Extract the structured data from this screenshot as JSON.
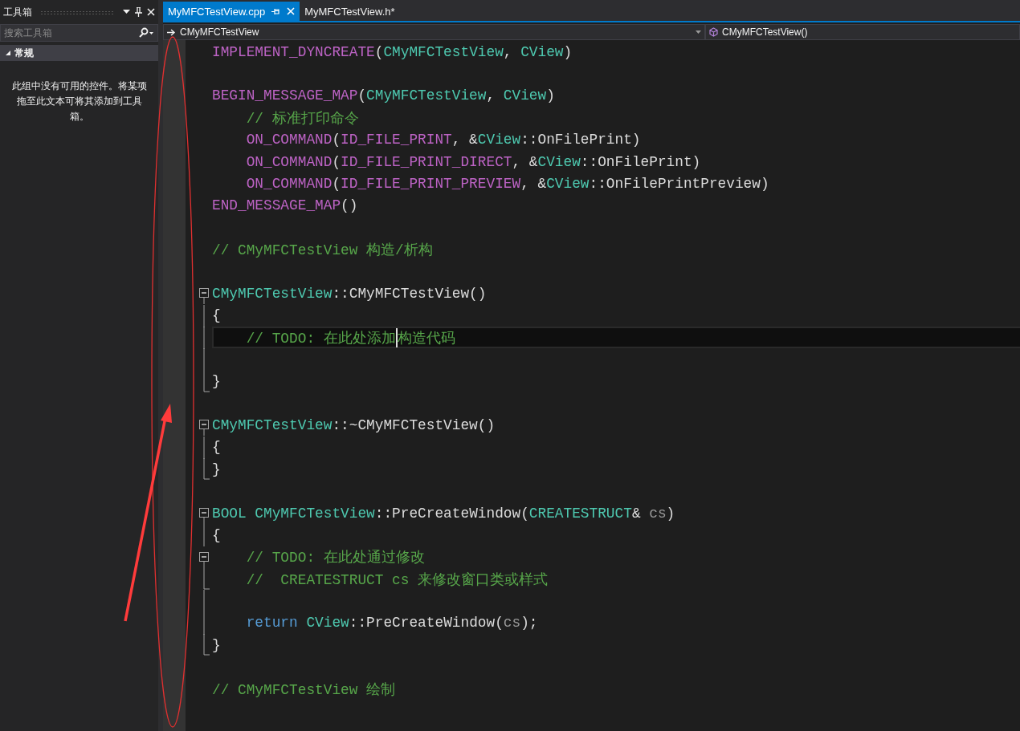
{
  "toolbox": {
    "title": "工具箱",
    "search": {
      "placeholder": "搜索工具箱"
    },
    "group": {
      "label": "常规",
      "expanded": true
    },
    "message": "此组中没有可用的控件。将某项拖至此文本可将其添加到工具箱。"
  },
  "tabs": [
    {
      "label": "MyMFCTestView.cpp",
      "selected": true
    },
    {
      "label": "MyMFCTestView.h*",
      "selected": false
    }
  ],
  "nav": {
    "scope": "CMyMFCTestView",
    "member": "CMyMFCTestView()"
  },
  "lines": [
    {
      "kind": "code",
      "tokens": [
        {
          "kind": "macro",
          "text": "IMPLEMENT_DYNCREATE"
        },
        {
          "kind": "text",
          "text": "("
        },
        {
          "kind": "type",
          "text": "CMyMFCTestView"
        },
        {
          "kind": "text",
          "text": ", "
        },
        {
          "kind": "type",
          "text": "CView"
        },
        {
          "kind": "text",
          "text": ")"
        }
      ]
    },
    {
      "kind": "blank"
    },
    {
      "kind": "code",
      "tokens": [
        {
          "kind": "macro",
          "text": "BEGIN_MESSAGE_MAP"
        },
        {
          "kind": "text",
          "text": "("
        },
        {
          "kind": "type",
          "text": "CMyMFCTestView"
        },
        {
          "kind": "text",
          "text": ", "
        },
        {
          "kind": "type",
          "text": "CView"
        },
        {
          "kind": "text",
          "text": ")"
        }
      ]
    },
    {
      "kind": "code",
      "tokens": [
        {
          "kind": "comment",
          "text": "    // 标准打印命令"
        }
      ]
    },
    {
      "kind": "code",
      "tokens": [
        {
          "kind": "macro",
          "text": "    ON_COMMAND"
        },
        {
          "kind": "text",
          "text": "("
        },
        {
          "kind": "macro",
          "text": "ID_FILE_PRINT"
        },
        {
          "kind": "text",
          "text": ", &"
        },
        {
          "kind": "type",
          "text": "CView"
        },
        {
          "kind": "text",
          "text": "::OnFilePrint)"
        }
      ]
    },
    {
      "kind": "code",
      "tokens": [
        {
          "kind": "macro",
          "text": "    ON_COMMAND"
        },
        {
          "kind": "text",
          "text": "("
        },
        {
          "kind": "macro",
          "text": "ID_FILE_PRINT_DIRECT"
        },
        {
          "kind": "text",
          "text": ", &"
        },
        {
          "kind": "type",
          "text": "CView"
        },
        {
          "kind": "text",
          "text": "::OnFilePrint)"
        }
      ]
    },
    {
      "kind": "code",
      "tokens": [
        {
          "kind": "macro",
          "text": "    ON_COMMAND"
        },
        {
          "kind": "text",
          "text": "("
        },
        {
          "kind": "macro",
          "text": "ID_FILE_PRINT_PREVIEW"
        },
        {
          "kind": "text",
          "text": ", &"
        },
        {
          "kind": "type",
          "text": "CView"
        },
        {
          "kind": "text",
          "text": "::OnFilePrintPreview)"
        }
      ]
    },
    {
      "kind": "code",
      "tokens": [
        {
          "kind": "macro",
          "text": "END_MESSAGE_MAP"
        },
        {
          "kind": "text",
          "text": "()"
        }
      ]
    },
    {
      "kind": "blank"
    },
    {
      "kind": "code",
      "tokens": [
        {
          "kind": "comment",
          "text": "// CMyMFCTestView 构造/析构"
        }
      ]
    },
    {
      "kind": "blank"
    },
    {
      "kind": "code",
      "collapsible": true,
      "tokens": [
        {
          "kind": "type",
          "text": "CMyMFCTestView"
        },
        {
          "kind": "text",
          "text": "::CMyMFCTestView()"
        }
      ]
    },
    {
      "kind": "code",
      "in_block": true,
      "tokens": [
        {
          "kind": "text",
          "text": "{"
        }
      ]
    },
    {
      "kind": "code",
      "in_block": true,
      "current": true,
      "tokens": [
        {
          "kind": "comment",
          "text": "    // TODO: 在此处添加"
        },
        {
          "kind": "comment",
          "text": "构造代码",
          "caret_before": true
        }
      ]
    },
    {
      "kind": "blank",
      "in_block": true
    },
    {
      "kind": "code",
      "block_end": true,
      "tokens": [
        {
          "kind": "text",
          "text": "}"
        }
      ]
    },
    {
      "kind": "blank"
    },
    {
      "kind": "code",
      "collapsible": true,
      "tokens": [
        {
          "kind": "type",
          "text": "CMyMFCTestView"
        },
        {
          "kind": "text",
          "text": "::~CMyMFCTestView()"
        }
      ]
    },
    {
      "kind": "code",
      "in_block": true,
      "tokens": [
        {
          "kind": "text",
          "text": "{"
        }
      ]
    },
    {
      "kind": "code",
      "block_end": true,
      "tokens": [
        {
          "kind": "text",
          "text": "}"
        }
      ]
    },
    {
      "kind": "blank"
    },
    {
      "kind": "code",
      "collapsible": true,
      "tokens": [
        {
          "kind": "type",
          "text": "BOOL CMyMFCTestView"
        },
        {
          "kind": "text",
          "text": "::PreCreateWindow("
        },
        {
          "kind": "type",
          "text": "CREATESTRUCT"
        },
        {
          "kind": "text",
          "text": "& "
        },
        {
          "kind": "param",
          "text": "cs"
        },
        {
          "kind": "text",
          "text": ")"
        }
      ]
    },
    {
      "kind": "code",
      "in_block": true,
      "tokens": [
        {
          "kind": "text",
          "text": "{"
        }
      ]
    },
    {
      "kind": "code",
      "collapsible": true,
      "tokens": [
        {
          "kind": "comment",
          "text": "    // TODO: 在此处通过修改"
        }
      ]
    },
    {
      "kind": "code",
      "block_end": true,
      "tokens": [
        {
          "kind": "comment",
          "text": "    //  CREATESTRUCT cs 来修改窗口类或样式"
        }
      ]
    },
    {
      "kind": "blank",
      "in_block": true
    },
    {
      "kind": "code",
      "in_block": true,
      "tokens": [
        {
          "kind": "keyword",
          "text": "    return "
        },
        {
          "kind": "type",
          "text": "CView"
        },
        {
          "kind": "text",
          "text": "::PreCreateWindow("
        },
        {
          "kind": "param",
          "text": "cs"
        },
        {
          "kind": "text",
          "text": ");"
        }
      ]
    },
    {
      "kind": "code",
      "block_end": true,
      "tokens": [
        {
          "kind": "text",
          "text": "}"
        }
      ]
    },
    {
      "kind": "blank"
    },
    {
      "kind": "code",
      "tokens": [
        {
          "kind": "comment",
          "text": "// CMyMFCTestView 绘制"
        }
      ]
    }
  ]
}
